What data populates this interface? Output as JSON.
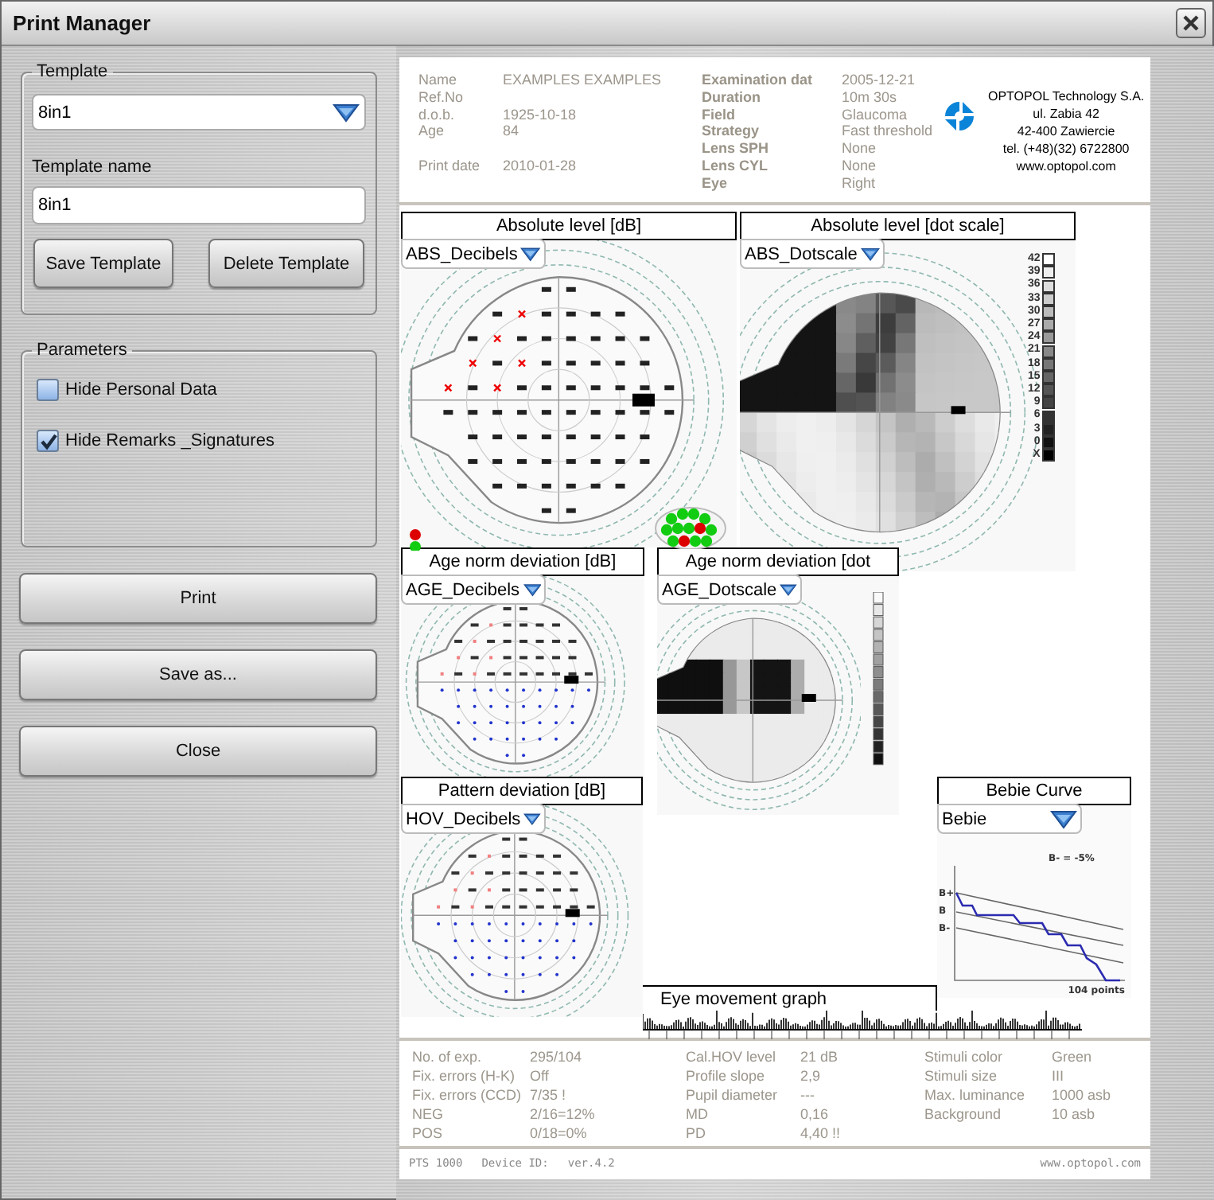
{
  "window": {
    "title": "Print Manager"
  },
  "template_group": {
    "label": "Template",
    "template": {
      "value": "8in1"
    },
    "name_label": "Template name",
    "name_field": {
      "value": "8in1"
    },
    "buttons": [
      "Save Template",
      "Delete Template"
    ]
  },
  "parameters": {
    "label": "Parameters",
    "options": [
      {
        "label": "Hide Personal Data",
        "checked": false
      },
      {
        "label": "Hide Remarks _Signatures",
        "checked": true
      }
    ]
  },
  "actions": [
    "Print",
    "Save as...",
    "Close"
  ],
  "report": {
    "patient": [
      {
        "label": "Name",
        "value": "EXAMPLES EXAMPLES"
      },
      {
        "label": "Ref.No"
      },
      {
        "label": "d.o.b.",
        "value": "1925-10-18"
      },
      {
        "label": "Age",
        "value": "84"
      },
      {
        "label": "Print date",
        "value": "2010-01-28"
      }
    ],
    "exam": [
      {
        "label": "Examination dat",
        "value": "2005-12-21"
      },
      {
        "label": "Duration",
        "value": "10m 30s"
      },
      {
        "label": "Field",
        "value": "Glaucoma"
      },
      {
        "label": "Strategy",
        "value": "Fast threshold"
      },
      {
        "label": "Lens SPH",
        "value": "None"
      },
      {
        "label": "Lens CYL",
        "value": "None"
      },
      {
        "label": "Eye",
        "value": "Right"
      }
    ],
    "company": [
      "OPTOPOL Technology S.A.",
      "ul. Zabia 42",
      "42-400 Zawiercie",
      "tel. (+48)(32) 6722800",
      "www.optopol.com"
    ],
    "panels": [
      {
        "title": "Absolute level [dB]",
        "selector": "ABS_Decibels",
        "kind": "decibels"
      },
      {
        "title": "Absolute level [dot scale]",
        "selector": "ABS_Dotscale",
        "kind": "dotscale",
        "scale": [
          "42",
          "39",
          "36",
          "33",
          "30",
          "27",
          "24",
          "21",
          "18",
          "15",
          "12",
          "9",
          "6",
          "3",
          "0",
          "X"
        ]
      },
      {
        "title": "Age norm deviation [dB]",
        "selector": "AGE_Decibels",
        "kind": "deviation"
      },
      {
        "title": "Age norm deviation [dot",
        "selector": "AGE_Dotscale",
        "kind": "deviation-dots"
      },
      {
        "title": "Pattern deviation [dB]",
        "selector": "HOV_Decibels",
        "kind": "deviation"
      },
      {
        "title": "Bebie Curve",
        "selector": "Bebie",
        "kind": "bebie",
        "labels": [
          "B+",
          "B",
          "B-"
        ],
        "legend": "B-  = -5%",
        "x_label": "104 points"
      }
    ],
    "eye_movement": {
      "title": "Eye movement graph"
    },
    "stats": [
      [
        {
          "label": "No. of exp.",
          "value": "295/104"
        },
        {
          "label": "Fix. errors (H-K)",
          "value": "Off"
        },
        {
          "label": "Fix. errors (CCD)",
          "value": "7/35 !"
        },
        {
          "label": "NEG",
          "value": "2/16=12%"
        },
        {
          "label": "POS",
          "value": "0/18=0%"
        }
      ],
      [
        {
          "label": "Cal.HOV level",
          "value": "21 dB"
        },
        {
          "label": "Profile slope",
          "value": "2,9"
        },
        {
          "label": "Pupil diameter",
          "value": "---"
        },
        {
          "label": "MD",
          "value": "0,16"
        },
        {
          "label": "PD",
          "value": "4,40 !!"
        }
      ],
      [
        {
          "label": "Stimuli color",
          "value": "Green"
        },
        {
          "label": "Stimuli size",
          "value": "III"
        },
        {
          "label": "Max. luminance",
          "value": "1000 asb"
        },
        {
          "label": "Background",
          "value": "10 asb"
        }
      ]
    ],
    "footer": {
      "device": "PTS 1000",
      "device_id_label": "Device ID:",
      "version": "ver.4.2",
      "website": "www.optopol.com"
    }
  }
}
